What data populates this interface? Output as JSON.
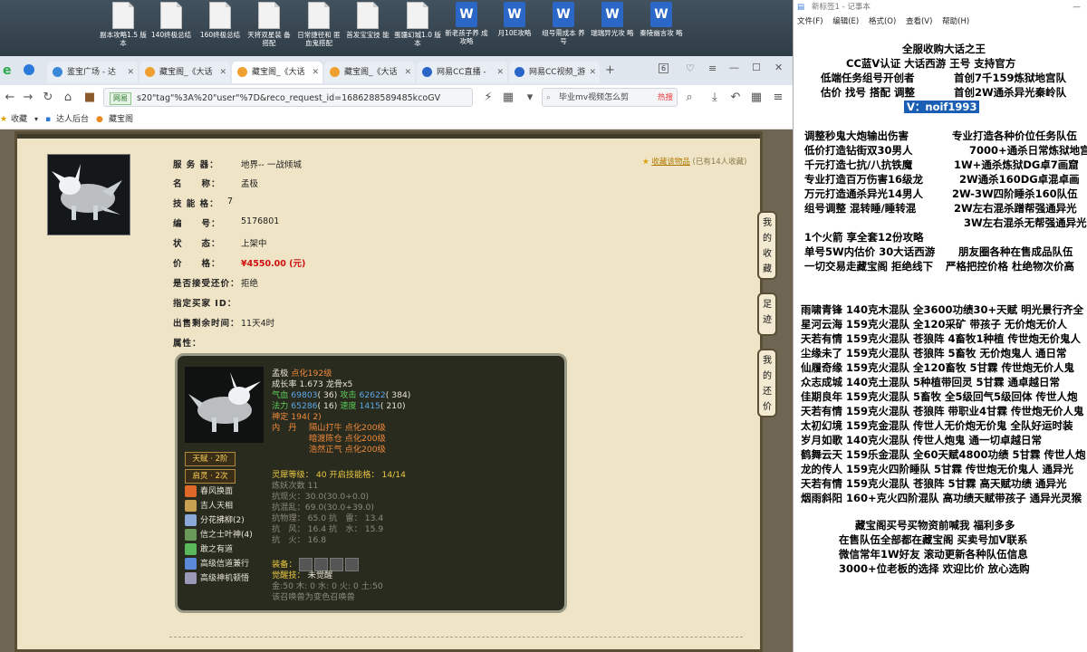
{
  "desktop": {
    "icons": [
      {
        "label": "副本攻略1.5 版本",
        "kind": "doc"
      },
      {
        "label": "140终极总结",
        "kind": "doc"
      },
      {
        "label": "160终极总结",
        "kind": "doc"
      },
      {
        "label": "天将双星装 备搭配",
        "kind": "doc"
      },
      {
        "label": "日常捷径和 匪血鬼搭配",
        "kind": "doc"
      },
      {
        "label": "首发宝宝技 能",
        "kind": "doc"
      },
      {
        "label": "蛋疆幻城1.0 版本",
        "kind": "doc"
      },
      {
        "label": "新老孩子养 成攻略",
        "kind": "word"
      },
      {
        "label": "月10E攻略",
        "kind": "word"
      },
      {
        "label": "组号需成本 养号",
        "kind": "word"
      },
      {
        "label": "瑞瑞异光攻 略",
        "kind": "word"
      },
      {
        "label": "秦陵幽言攻 略",
        "kind": "word"
      }
    ]
  },
  "browser": {
    "tabs": [
      {
        "label": "鉴宝广场 - 达",
        "active": false
      },
      {
        "label": "藏宝阁_《大话",
        "active": false
      },
      {
        "label": "藏宝阁_《大话",
        "active": true
      },
      {
        "label": "藏宝阁_《大话",
        "active": false
      },
      {
        "label": "网易CC直播 -",
        "active": false
      },
      {
        "label": "网易CC视频_游",
        "active": false
      }
    ],
    "tab_count": "6",
    "url_badge": "网易",
    "url": "s20\"tag\"%3A%20\"user\"%7D&reco_request_id=1686288589485kcoGV",
    "search_text": "毕业mv视频怎么剪",
    "search_hot": "热搜",
    "bookmarks": [
      "收藏",
      "达人后台",
      "藏宝阁"
    ]
  },
  "listing": {
    "server_label": "服 务 器：",
    "server": "地界-- 一战倾城",
    "name_label": "名　　称：",
    "name": "孟极",
    "skill_label": "技 能 格：",
    "skill_slots": "7",
    "id_label": "编　　号：",
    "id": "5176801",
    "status_label": "状　　态：",
    "status": "上架中",
    "price_label": "价　　格：",
    "price": "¥4550.00 (元)",
    "bargain_label": "是否接受还价：",
    "bargain": "拒绝",
    "buyer_label": "指定买家 ID：",
    "buyer": "",
    "time_label": "出售剩余时间：",
    "time_left": "11天4时",
    "attr_label": "属性：",
    "collect_link": "收藏该物品",
    "collect_count": "(已有14人收藏)"
  },
  "side_tabs": [
    "我的收藏",
    "足迹",
    "我的还价"
  ],
  "pet_card": {
    "name": "孟极",
    "name_extra": "点化192级",
    "growth": "成长率 1.673 龙骨x5",
    "hp_label": "气血",
    "hp": "69803",
    "hp_extra": "( 36)",
    "atk_label": "攻击",
    "atk": "62622",
    "atk_extra": "( 384)",
    "mp_label": "法力",
    "mp": "65286",
    "mp_extra": "( 16)",
    "spd_label": "速度",
    "spd": "1415",
    "spd_extra": "( 210)",
    "shen": "神定 194( 2)",
    "inner_label": "内　丹",
    "inner": [
      "隔山打牛 点化200级",
      "暗渡陈仓 点化200级",
      "浩然正气 点化200级"
    ],
    "talent": "天赋 · 2阶",
    "rebirth": "启灵 · 2次",
    "skills": [
      "春风换面",
      "吉人天相",
      "分花拂柳(2)",
      "信之士叶神(4)",
      "敢之有道",
      "高级信道兼行",
      "高级神机顿悟"
    ],
    "spirit": "灵犀等级： 40 开启技能格： 14/14",
    "refine": "炼妖次数 11",
    "kangxian": "抗现火：30.0(30.0+0.0)",
    "kanghun": "抗混乱：69.0(30.0+39.0)",
    "physics": "抗物理： 65.0 抗　雷： 13.4",
    "wind": "抗　风： 16.4 抗　水： 15.9",
    "fire": "抗　火： 16.8",
    "equip_label": "装备：",
    "awake_label": "觉醒技：",
    "awake": "未觉醒",
    "elements": "金:50 木: 0 水: 0 火: 0 土:50",
    "note": "该召唤兽为变色召唤兽"
  },
  "notepad": {
    "title": "新标签1 - 记事本",
    "menu": [
      "文件(F)",
      "编辑(E)",
      "格式(O)",
      "查看(V)",
      "帮助(H)"
    ],
    "lines": [
      "全服收购大话之王",
      "CC蓝V认证  大话西游 王号 支持官方",
      "低端任务组号开创者",
      "首创7千159炼狱地宫队",
      "估价 找号 搭配 调整",
      "首创2W通杀异光秦岭队",
      "V：noif1993",
      "调整秒鬼大炮输出伤害",
      "专业打造各种价位任务队伍",
      "低价打造钻街双30男人",
      "7000+通杀日常炼狱地宫",
      "千元打造七抗/八抗铁魔",
      "1W+通杀炼狱DG卓7画窟",
      "专业打造百万伤害16级龙",
      "2W通杀160DG卓混卓画",
      "万元打造通杀异光14男人",
      "2W-3W四阶睡杀160队伍",
      "组号调整 混转睡/睡转混",
      "2W左右混杀蹭帮强通异光",
      "3W左右混杀无帮强通异光",
      "1个火箭 享全套12份攻略",
      "单号5W内估价 30大话西游",
      "朋友圈各种在售成品队伍",
      "一切交易走藏宝阁 拒绝线下",
      "严格把控价格 杜绝物次价高",
      "雨啸青锋 140克木混队 全3600功绩30+天赋 明光景行齐全",
      "星河云海 159克火混队 全120采矿 带孩子 无价炮无价人",
      "天若有情 159克火混队 苍狼阵 4畜牧1种植 传世炮无价鬼人",
      "尘缘未了 159克火混队 苍狼阵 5畜牧 无价炮鬼人 通日常",
      "仙履奇缘 159克火混队 全120畜牧 5甘霖 传世炮无价人鬼",
      "众志成城 140克土混队 5种植带回灵 5甘霖 通卓越日常",
      "佳期良年 159克火混队 5畜牧 全5级回气5级回体 传世人炮",
      "天若有情 159克火混队 苍狼阵 带职业4甘霖 传世炮无价人鬼",
      "太初幻境 159克金混队 传世人无价炮无价鬼 全队好运时装",
      "岁月如歌 140克火混队 传世人炮鬼 通一切卓越日常",
      "鹤舞云天 159乐金混队 全60天赋4800功绩 5甘霖 传世人炮",
      "龙的传人 159克火四阶睡队 5甘霖 传世炮无价鬼人 通异光",
      "天若有情 159克火混队 苍狼阵 5甘霖 高天赋功绩 通异光",
      "烟雨斜阳 160+克火四阶混队 高功绩天赋带孩子 通异光灵猴",
      "藏宝阁买号买物资前喊我 福利多多",
      "在售队伍全部都在藏宝阁 买卖号加V联系",
      "微信常年1W好友 滚动更新各种队伍信息",
      "3000+位老板的选择 欢迎比价 放心选购"
    ]
  },
  "colors": {
    "accent_red": "#d01010",
    "selection_blue": "#1a5fb4",
    "card_bg": "#2a2b1f"
  }
}
